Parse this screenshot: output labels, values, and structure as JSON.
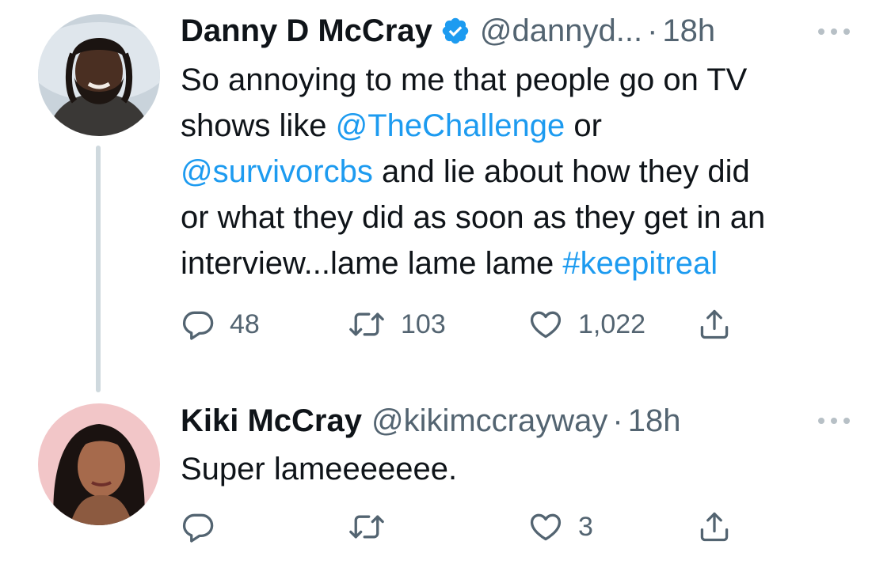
{
  "tweets": [
    {
      "display_name": "Danny D McCray",
      "verified": true,
      "handle": "@dannyd...",
      "separator": "·",
      "time": "18h",
      "body_lines": [
        [
          {
            "text": "So annoying to me that people go on TV",
            "link": false
          }
        ],
        [
          {
            "text": "shows like ",
            "link": false
          },
          {
            "text": "@TheChallenge",
            "link": true
          },
          {
            "text": " or",
            "link": false
          }
        ],
        [
          {
            "text": "@survivorcbs",
            "link": true
          },
          {
            "text": " and lie about how they did",
            "link": false
          }
        ],
        [
          {
            "text": "or what they did as soon as they get in an",
            "link": false
          }
        ],
        [
          {
            "text": "interview...lame lame lame ",
            "link": false
          },
          {
            "text": "#keepitreal",
            "link": true
          }
        ]
      ],
      "actions": {
        "replies": "48",
        "retweets": "103",
        "likes": "1,022"
      }
    },
    {
      "display_name": "Kiki McCray",
      "verified": false,
      "handle": "@kikimccrayway",
      "separator": "·",
      "time": "18h",
      "body_lines": [
        [
          {
            "text": "Super lameeeeeee.",
            "link": false
          }
        ]
      ],
      "actions": {
        "replies": "",
        "retweets": "",
        "likes": "3"
      }
    }
  ],
  "icons": {
    "verified": "verified-badge-icon",
    "more": "more-options-icon",
    "reply": "reply-icon",
    "retweet": "retweet-icon",
    "like": "heart-icon",
    "share": "share-icon"
  },
  "colors": {
    "link": "#1d9bf0",
    "secondary_text": "#536471",
    "thread_line": "#cfd9de",
    "verified": "#1d9bf0"
  }
}
